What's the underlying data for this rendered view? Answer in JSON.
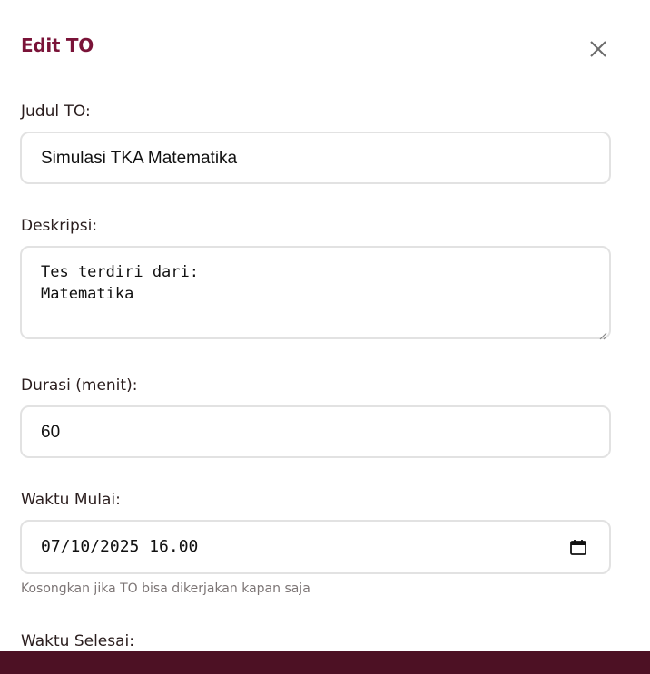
{
  "modal": {
    "title": "Edit TO",
    "close_icon": "close-icon"
  },
  "fields": {
    "title": {
      "label": "Judul TO:",
      "value": "Simulasi TKA Matematika"
    },
    "description": {
      "label": "Deskripsi:",
      "value": "Tes terdiri dari:\nMatematika"
    },
    "duration": {
      "label": "Durasi (menit):",
      "value": "60"
    },
    "start_time": {
      "label": "Waktu Mulai:",
      "value": "07/10/2025 16.00",
      "hint": "Kosongkan jika TO bisa dikerjakan kapan saja",
      "icon": "calendar-icon"
    },
    "end_time": {
      "label": "Waktu Selesai:"
    }
  },
  "colors": {
    "title": "#7a1338",
    "bottom_bar": "#4d1124",
    "border": "#e2e2e2",
    "hint": "#7c7575"
  }
}
